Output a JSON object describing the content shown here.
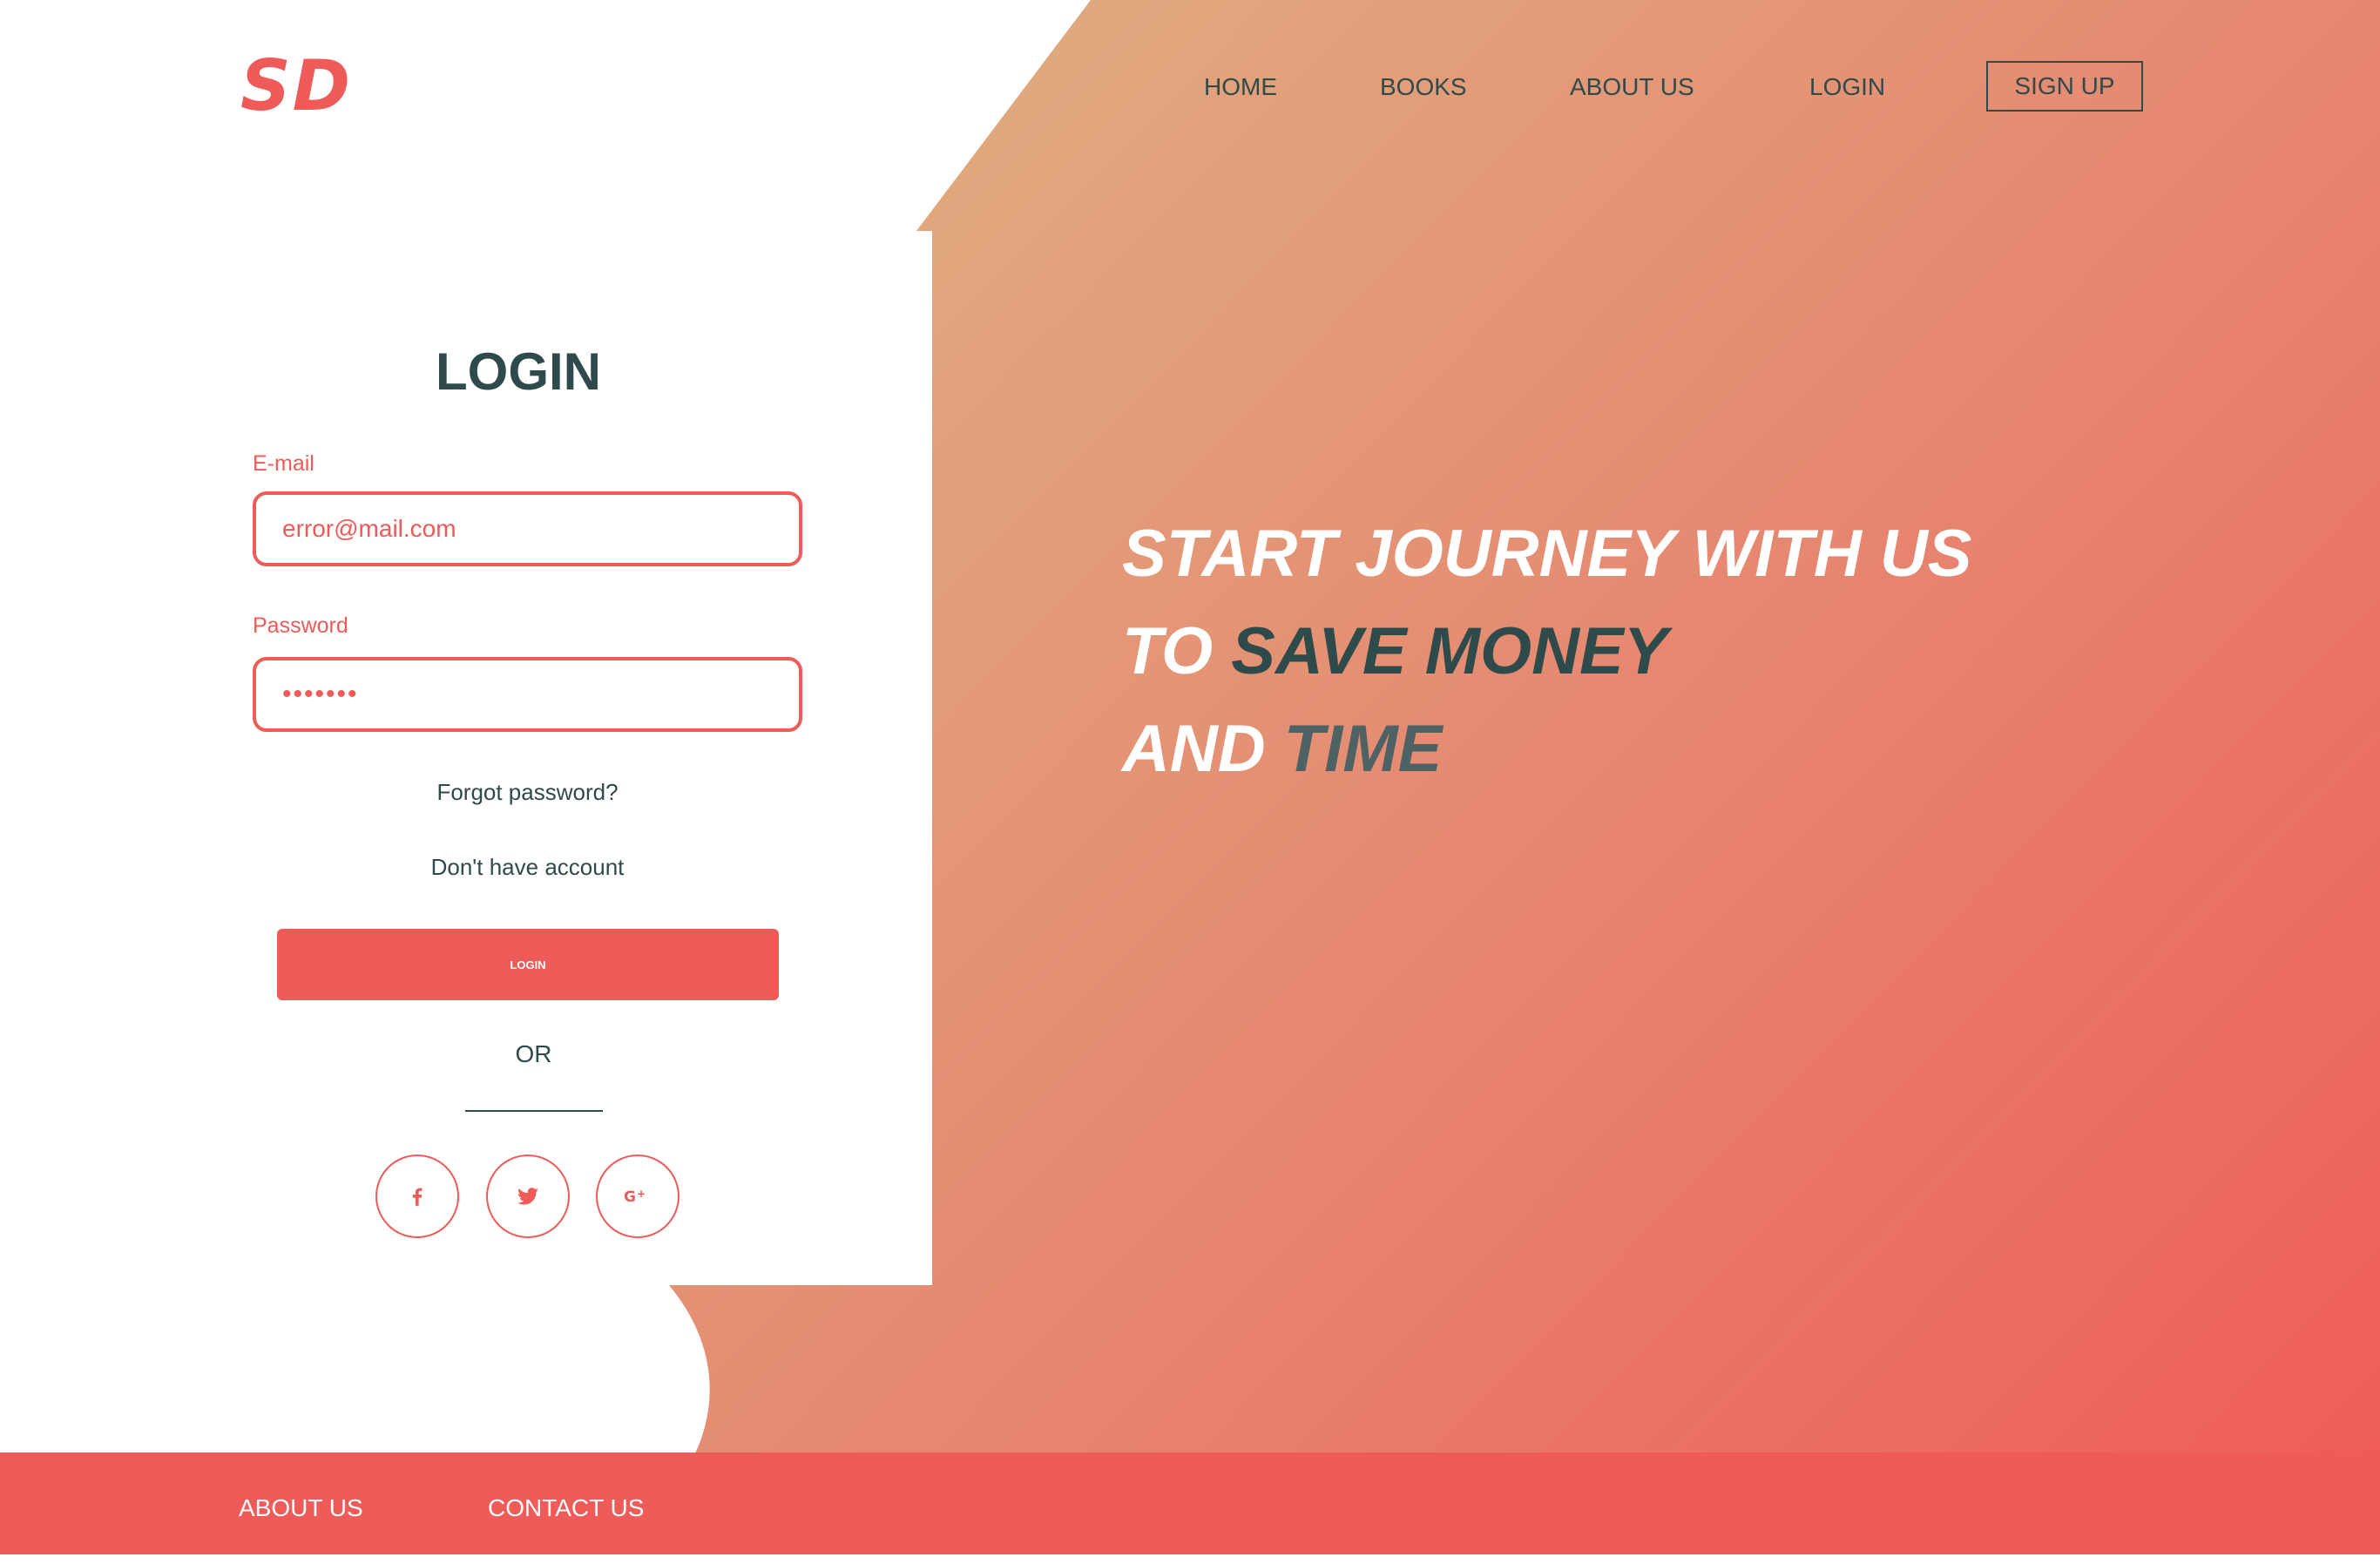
{
  "brand": {
    "logo_text": "SD"
  },
  "nav": {
    "items": [
      "HOME",
      "BOOKS",
      "ABOUT US",
      "LOGIN"
    ],
    "signup_label": "SIGN UP"
  },
  "login_form": {
    "title": "LOGIN",
    "email_label": "E-mail",
    "email_value": "error@mail.com",
    "password_label": "Password",
    "password_value": "•••••••",
    "forgot_password": "Forgot password?",
    "no_account": "Don't have account",
    "submit_label": "LOGIN",
    "or_text": "OR",
    "social_icons": [
      "facebook-icon",
      "twitter-icon",
      "google-plus-icon"
    ]
  },
  "hero": {
    "line1": "START JOURNEY WITH US",
    "line2_a": "TO ",
    "line2_b": "SAVE MONEY",
    "line3_a": "AND ",
    "line3_b": "TIME"
  },
  "footer": {
    "links": [
      "ABOUT US",
      "CONTACT US"
    ]
  },
  "colors": {
    "accent": "#ee5b58",
    "dark_text": "#2f4a4b",
    "gradient_start": "#dfaf80",
    "gradient_end": "#ef5c57"
  }
}
